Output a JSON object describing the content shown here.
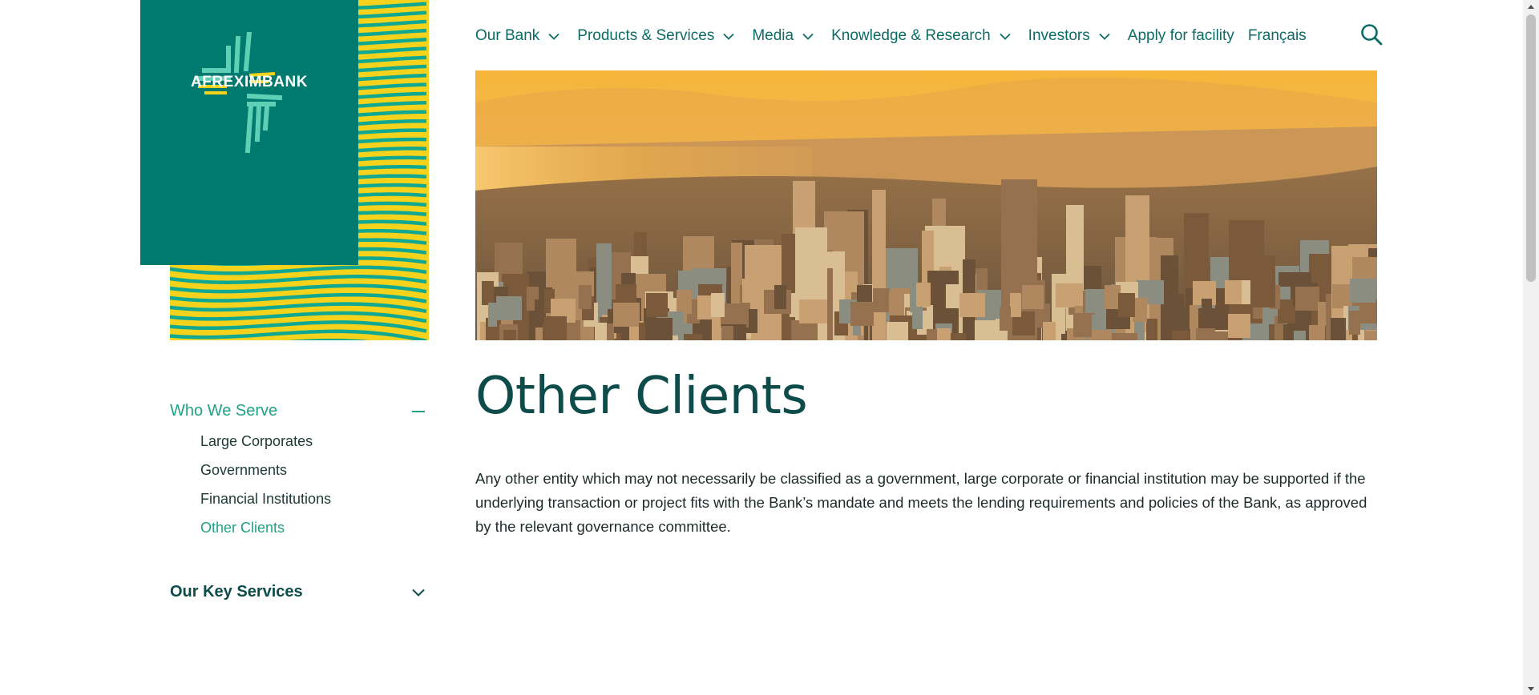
{
  "logo": {
    "text": "AFREXIMBANK"
  },
  "nav": {
    "items": [
      {
        "label": "Our Bank",
        "has_dropdown": true
      },
      {
        "label": "Products & Services",
        "has_dropdown": true
      },
      {
        "label": "Media",
        "has_dropdown": true
      },
      {
        "label": "Knowledge & Research",
        "has_dropdown": true
      },
      {
        "label": "Investors",
        "has_dropdown": true
      },
      {
        "label": "Apply for facility",
        "has_dropdown": false
      },
      {
        "label": "Français",
        "has_dropdown": false
      }
    ],
    "search_icon": "search-icon"
  },
  "sidebar": {
    "sections": [
      {
        "label": "Who We Serve",
        "expanded": true,
        "toggle_icon": "minus-icon",
        "items": [
          {
            "label": "Large Corporates",
            "current": false
          },
          {
            "label": "Governments",
            "current": false
          },
          {
            "label": "Financial Institutions",
            "current": false
          },
          {
            "label": "Other Clients",
            "current": true
          }
        ]
      },
      {
        "label": "Our Key Services",
        "expanded": false,
        "toggle_icon": "chevron-down-icon"
      }
    ]
  },
  "main": {
    "title": "Other Clients",
    "body": "Any other entity which may not necessarily be classified as a government, large corporate or financial institution may be supported if the underlying transaction or project fits with the Bank’s mandate and meets the lending requirements and policies of the Bank, as approved by the relevant governance committee."
  },
  "colors": {
    "brand_teal": "#007a6e",
    "brand_yellow": "#f5d31c",
    "accent_green": "#1fa184",
    "nav_text": "#0d6b66",
    "heading": "#0d4c4a"
  }
}
